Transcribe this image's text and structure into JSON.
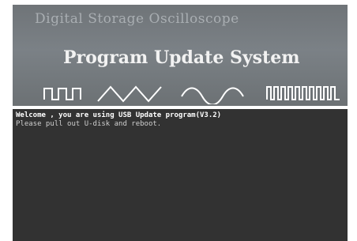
{
  "banner": {
    "brand": "Digital Storage Oscilloscope",
    "title": "Program Update System",
    "waveforms": [
      "square-wave-icon",
      "triangle-wave-icon",
      "sine-wave-icon",
      "pulse-train-icon"
    ]
  },
  "console": {
    "lines": [
      "Welcome , you are using USB Update program(V3.2)",
      "Please pull out U-disk and reboot."
    ]
  },
  "colors": {
    "banner_gray": "#767b80",
    "screen_bg": "#323232",
    "wave_white": "#ffffff"
  }
}
